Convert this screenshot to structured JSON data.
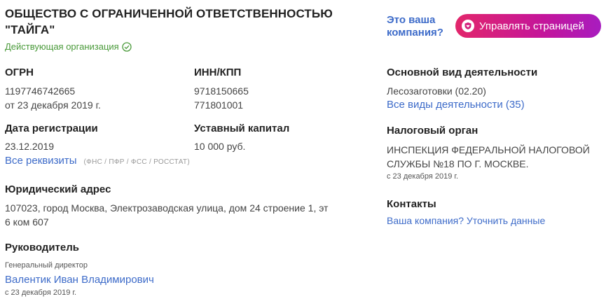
{
  "company": {
    "title": "ОБЩЕСТВО С ОГРАНИЧЕННОЙ ОТВЕТСТВЕННОСТЬЮ \"ТАЙГА\"",
    "status": "Действующая организация"
  },
  "claim": {
    "question_line1": "Это ваша",
    "question_line2": "компания?",
    "manage_button": "Управлять страницей"
  },
  "ogrn": {
    "label": "ОГРН",
    "value": "1197746742665",
    "date": "от 23 декабря 2019 г."
  },
  "inn": {
    "label": "ИНН/КПП",
    "inn_value": "9718150665",
    "kpp_value": "771801001"
  },
  "registration": {
    "label": "Дата регистрации",
    "value": "23.12.2019"
  },
  "capital": {
    "label": "Уставный капитал",
    "value": "10 000 руб."
  },
  "requisites": {
    "link": "Все реквизиты",
    "note": "(ФНС / ПФР / ФСС / РОССТАТ)"
  },
  "address": {
    "label": "Юридический адрес",
    "line1": "107023, город Москва, Электрозаводская улица, дом 24 строение 1, эт",
    "line2": "6 ком 607"
  },
  "director": {
    "label": "Руководитель",
    "position": "Генеральный директор",
    "name": "Валентик Иван Владимирович",
    "since": "с 23 декабря 2019 г."
  },
  "activity": {
    "label": "Основной вид деятельности",
    "value": "Лесозаготовки (02.20)",
    "all_link": "Все виды деятельности (35)"
  },
  "tax": {
    "label": "Налоговый орган",
    "line1": "ИНСПЕКЦИЯ ФЕДЕРАЛЬНОЙ НАЛОГОВОЙ",
    "line2": "СЛУЖБЫ №18 ПО Г. МОСКВЕ.",
    "since": "с 23 декабря 2019 г."
  },
  "contacts": {
    "label": "Контакты",
    "link": "Ваша компания? Уточнить данные"
  },
  "colors": {
    "link": "#3d6bc9",
    "status": "#4a9a3a",
    "button_gradient_start": "#e2266b",
    "button_gradient_end": "#a81cbf"
  },
  "icons": {
    "status": "check-circle-icon",
    "manage": "shield-heart-icon"
  }
}
